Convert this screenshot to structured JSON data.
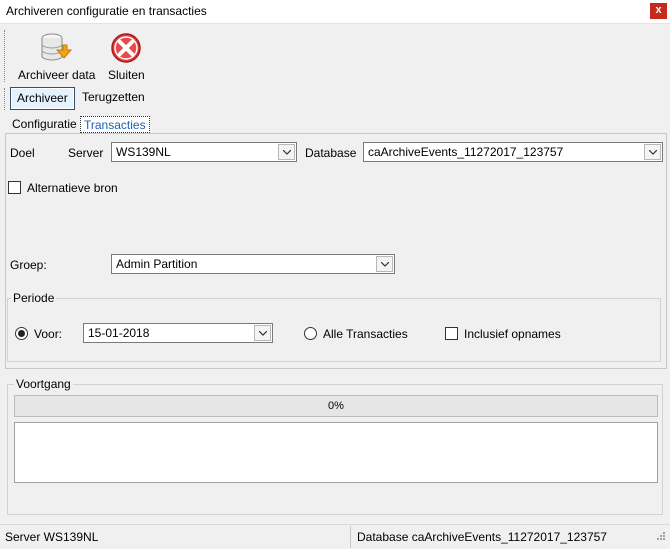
{
  "window": {
    "title": "Archiveren configuratie en transacties",
    "close_glyph": "x"
  },
  "toolbar": {
    "archive_data_label": "Archiveer data",
    "close_label": "Sluiten"
  },
  "mode_tabs": [
    {
      "label": "Archiveer",
      "active": true
    },
    {
      "label": "Terugzetten",
      "active": false
    }
  ],
  "sub_tabs": [
    {
      "label": "Configuratie",
      "active": false
    },
    {
      "label": "Transacties",
      "active": true
    }
  ],
  "form": {
    "doel_label": "Doel",
    "server_label": "Server",
    "server_value": "WS139NL",
    "database_label": "Database",
    "database_value": "caArchiveEvents_11272017_123757",
    "alt_source_label": "Alternatieve bron",
    "groep_label": "Groep:",
    "groep_value": "Admin Partition"
  },
  "periode": {
    "legend": "Periode",
    "voor_label": "Voor:",
    "date_value": "15-01-2018",
    "all_transactions_label": "Alle Transacties",
    "include_withdrawals_label": "Inclusief opnames"
  },
  "progress": {
    "legend": "Voortgang",
    "value": 0,
    "text": "0%"
  },
  "statusbar": {
    "server_text": "Server WS139NL",
    "database_text": "Database caArchiveEvents_11272017_123757"
  },
  "icons": {
    "archive": "database-archive-icon",
    "close": "red-x-icon"
  }
}
